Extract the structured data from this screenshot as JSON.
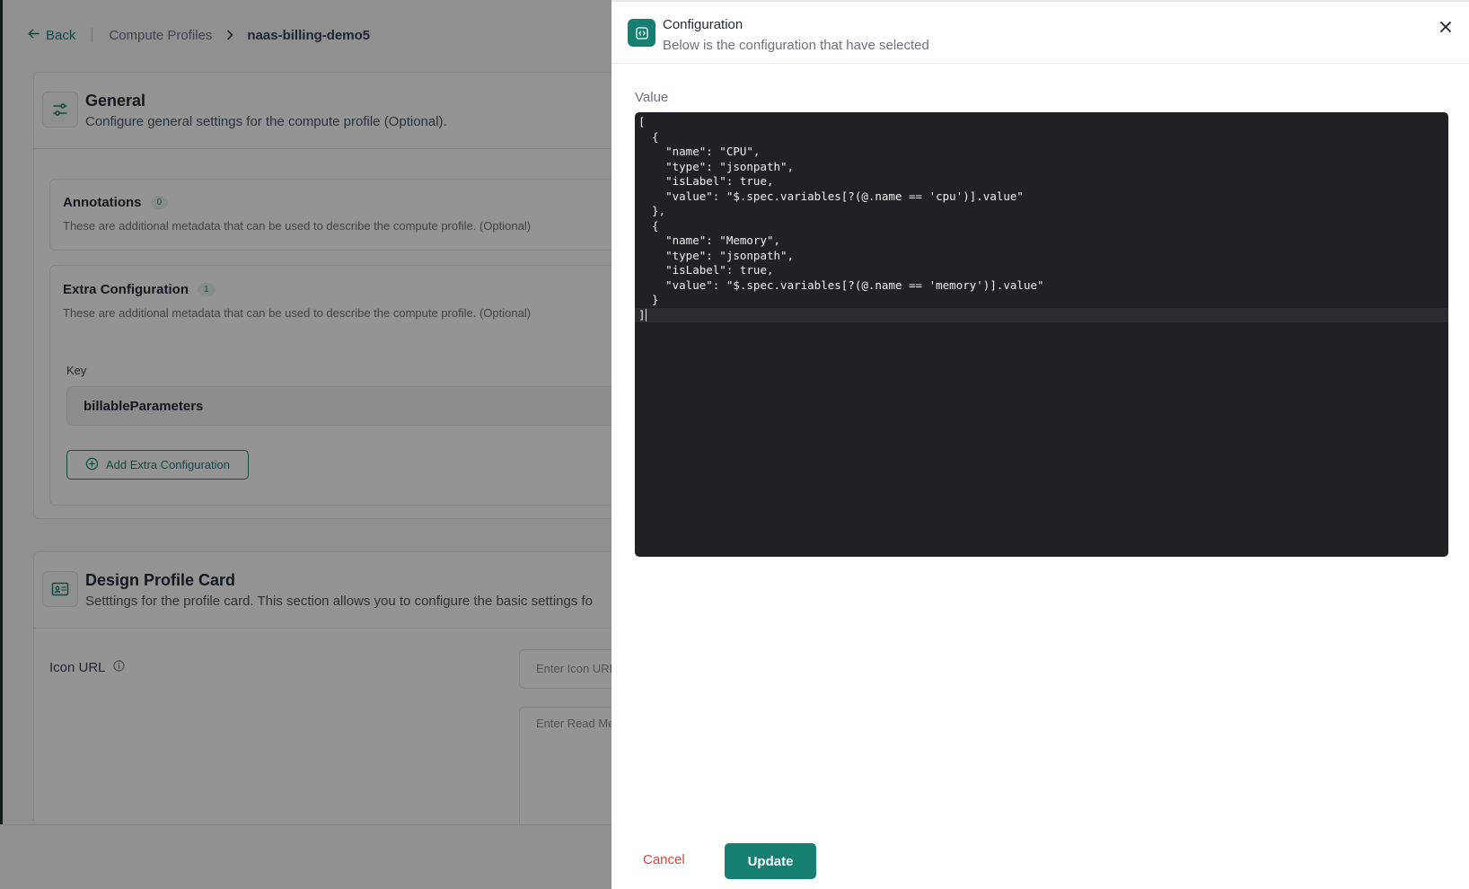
{
  "breadcrumb": {
    "back_label": "Back",
    "parent": "Compute Profiles",
    "current": "naas-billing-demo5"
  },
  "general": {
    "title": "General",
    "subtitle": "Configure general settings for the compute profile (Optional).",
    "annotations": {
      "title": "Annotations",
      "count": "0",
      "description": "These are additional metadata that can be used to describe the compute profile. (Optional)"
    },
    "extra_configuration": {
      "title": "Extra Configuration",
      "count": "1",
      "description": "These are additional metadata that can be used to describe the compute profile. (Optional)",
      "key_label": "Key",
      "key_value": "billableParameters",
      "add_button": "Add Extra Configuration"
    }
  },
  "design_card": {
    "title": "Design Profile Card",
    "subtitle": "Setttings for the profile card. This section allows you to configure the basic settings fo",
    "icon_url_label": "Icon URL",
    "icon_url_placeholder": "Enter Icon URL",
    "readme_placeholder": "Enter Read Me"
  },
  "drawer": {
    "title": "Configuration",
    "subtitle": "Below is the configuration that have selected",
    "value_label": "Value",
    "code_lines": [
      "[",
      "  {",
      "    \"name\": \"CPU\",",
      "    \"type\": \"jsonpath\",",
      "    \"isLabel\": true,",
      "    \"value\": \"$.spec.variables[?(@.name == 'cpu')].value\"",
      "  },",
      "  {",
      "    \"name\": \"Memory\",",
      "    \"type\": \"jsonpath\",",
      "    \"isLabel\": true,",
      "    \"value\": \"$.spec.variables[?(@.name == 'memory')].value\"",
      "  }",
      "]"
    ],
    "cancel_label": "Cancel",
    "update_label": "Update"
  },
  "colors": {
    "accent": "#177f71",
    "danger": "#e0443a",
    "editor_bg": "#202124"
  }
}
